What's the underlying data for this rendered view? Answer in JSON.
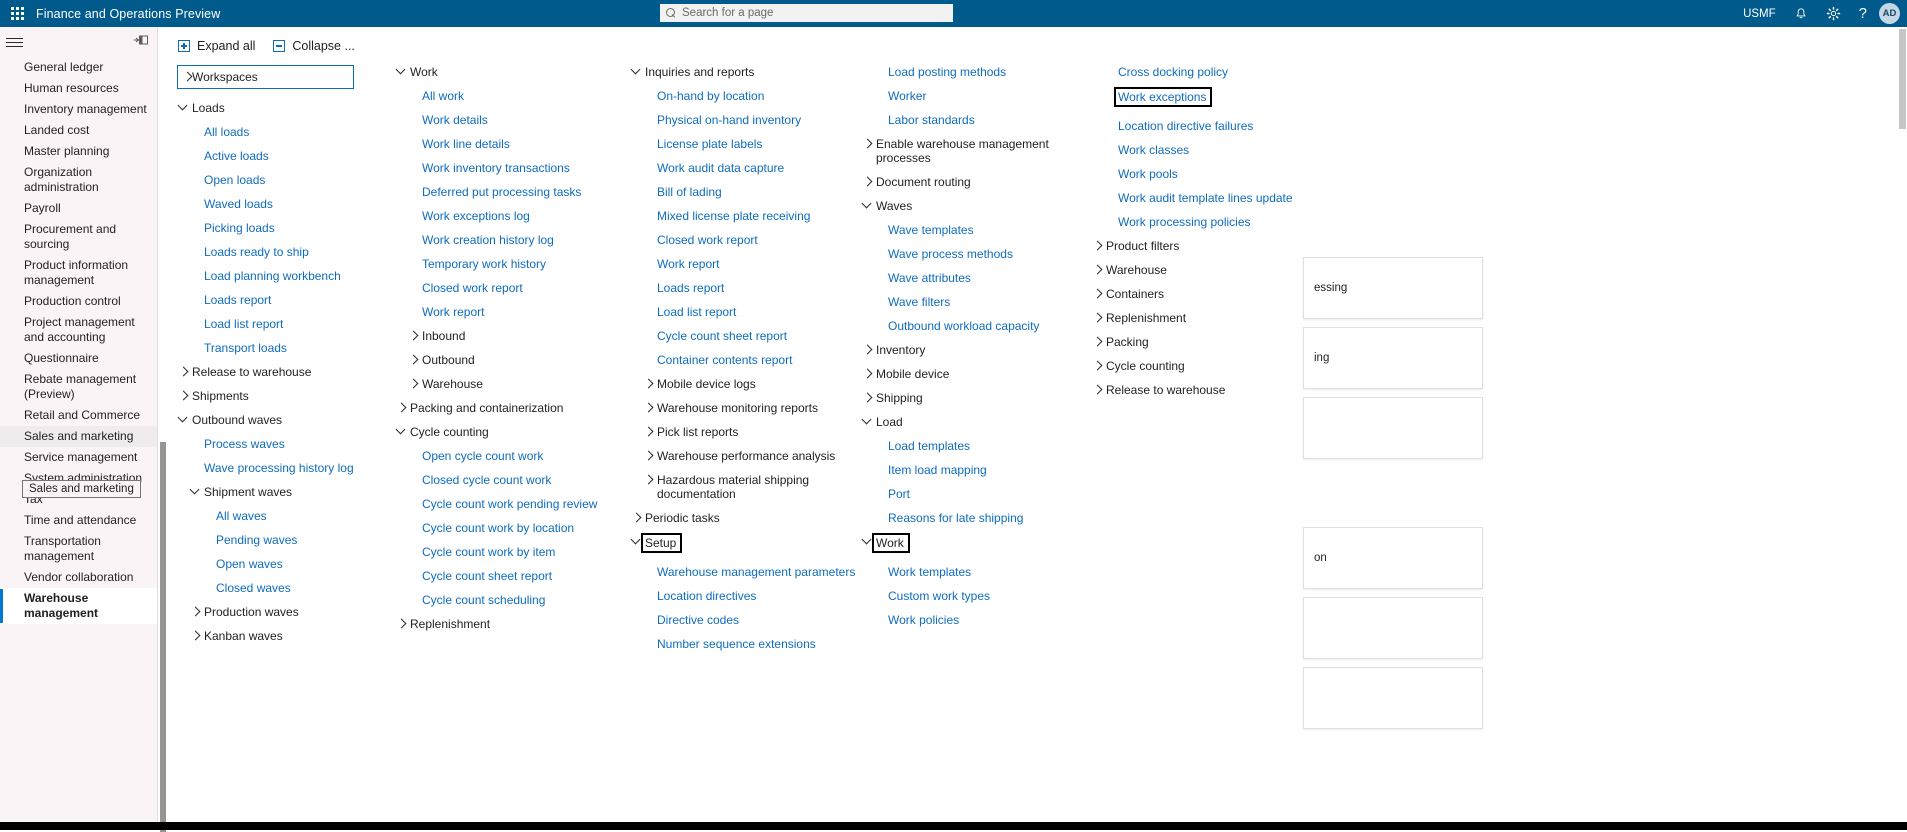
{
  "header": {
    "app_title": "Finance and Operations Preview",
    "waffle_icon": "waffle-grid-icon",
    "search_placeholder": "Search for a page",
    "search_icon": "search-icon",
    "company": "USMF",
    "notifications_icon": "bell-icon",
    "settings_icon": "gear-icon",
    "help_icon": "question-mark-icon",
    "avatar_initials": "AD",
    "accent_color": "#005A8C",
    "link_color": "#0F6CBD"
  },
  "sidebar": {
    "hamburger_icon": "hamburger-menu-icon",
    "pin_icon": "pin-panel-icon",
    "tooltip": "Sales and marketing",
    "items": [
      {
        "label": "General ledger",
        "state": "normal"
      },
      {
        "label": "Human resources",
        "state": "normal"
      },
      {
        "label": "Inventory management",
        "state": "normal"
      },
      {
        "label": "Landed cost",
        "state": "normal"
      },
      {
        "label": "Master planning",
        "state": "normal"
      },
      {
        "label": "Organization administration",
        "state": "normal"
      },
      {
        "label": "Payroll",
        "state": "normal"
      },
      {
        "label": "Procurement and sourcing",
        "state": "normal"
      },
      {
        "label": "Product information management",
        "state": "normal"
      },
      {
        "label": "Production control",
        "state": "normal"
      },
      {
        "label": "Project management and accounting",
        "state": "normal"
      },
      {
        "label": "Questionnaire",
        "state": "normal"
      },
      {
        "label": "Rebate management (Preview)",
        "state": "normal"
      },
      {
        "label": "Retail and Commerce",
        "state": "normal"
      },
      {
        "label": "Sales and marketing",
        "state": "hovered"
      },
      {
        "label": "Service management",
        "state": "normal"
      },
      {
        "label": "System administration",
        "state": "normal"
      },
      {
        "label": "Tax",
        "state": "normal"
      },
      {
        "label": "Time and attendance",
        "state": "normal"
      },
      {
        "label": "Transportation management",
        "state": "normal"
      },
      {
        "label": "Vendor collaboration",
        "state": "normal"
      },
      {
        "label": "Warehouse management",
        "state": "selected"
      }
    ]
  },
  "toolbar": {
    "expand_all": "Expand all",
    "collapse_all": "Collapse ...",
    "expand_icon": "expand-all-plus-icon",
    "collapse_icon": "collapse-all-minus-icon"
  },
  "columns": [
    {
      "id": "col1",
      "entries": [
        {
          "label": "Workspaces",
          "type": "group",
          "chev": "right",
          "focus": true
        },
        {
          "label": "Loads",
          "type": "group",
          "chev": "down"
        },
        {
          "label": "All loads",
          "type": "leaf"
        },
        {
          "label": "Active loads",
          "type": "leaf"
        },
        {
          "label": "Open loads",
          "type": "leaf"
        },
        {
          "label": "Waved loads",
          "type": "leaf"
        },
        {
          "label": "Picking loads",
          "type": "leaf"
        },
        {
          "label": "Loads ready to ship",
          "type": "leaf"
        },
        {
          "label": "Load planning workbench",
          "type": "leaf"
        },
        {
          "label": "Loads report",
          "type": "leaf"
        },
        {
          "label": "Load list report",
          "type": "leaf"
        },
        {
          "label": "Transport loads",
          "type": "leaf"
        },
        {
          "label": "Release to warehouse",
          "type": "group",
          "chev": "right"
        },
        {
          "label": "Shipments",
          "type": "group",
          "chev": "right"
        },
        {
          "label": "Outbound waves",
          "type": "group",
          "chev": "down"
        },
        {
          "label": "Process waves",
          "type": "leaf"
        },
        {
          "label": "Wave processing history log",
          "type": "leaf"
        },
        {
          "label": "Shipment waves",
          "type": "group-sub",
          "chev": "down"
        },
        {
          "label": "All waves",
          "type": "leaf-deep"
        },
        {
          "label": "Pending waves",
          "type": "leaf-deep"
        },
        {
          "label": "Open waves",
          "type": "leaf-deep"
        },
        {
          "label": "Closed waves",
          "type": "leaf-deep"
        },
        {
          "label": "Production waves",
          "type": "group-sub",
          "chev": "right"
        },
        {
          "label": "Kanban waves",
          "type": "group-sub",
          "chev": "right"
        }
      ]
    },
    {
      "id": "col2",
      "entries": [
        {
          "label": "Work",
          "type": "group",
          "chev": "down"
        },
        {
          "label": "All work",
          "type": "leaf"
        },
        {
          "label": "Work details",
          "type": "leaf"
        },
        {
          "label": "Work line details",
          "type": "leaf"
        },
        {
          "label": "Work inventory transactions",
          "type": "leaf"
        },
        {
          "label": "Deferred put processing tasks",
          "type": "leaf"
        },
        {
          "label": "Work exceptions log",
          "type": "leaf"
        },
        {
          "label": "Work creation history log",
          "type": "leaf"
        },
        {
          "label": "Temporary work history",
          "type": "leaf"
        },
        {
          "label": "Closed work report",
          "type": "leaf"
        },
        {
          "label": "Work report",
          "type": "leaf"
        },
        {
          "label": "Inbound",
          "type": "group-sub",
          "chev": "right"
        },
        {
          "label": "Outbound",
          "type": "group-sub",
          "chev": "right"
        },
        {
          "label": "Warehouse",
          "type": "group-sub",
          "chev": "right"
        },
        {
          "label": "Packing and containerization",
          "type": "group",
          "chev": "right"
        },
        {
          "label": "Cycle counting",
          "type": "group",
          "chev": "down"
        },
        {
          "label": "Open cycle count work",
          "type": "leaf"
        },
        {
          "label": "Closed cycle count work",
          "type": "leaf"
        },
        {
          "label": "Cycle count work pending review",
          "type": "leaf"
        },
        {
          "label": "Cycle count work by location",
          "type": "leaf"
        },
        {
          "label": "Cycle count work by item",
          "type": "leaf"
        },
        {
          "label": "Cycle count sheet report",
          "type": "leaf"
        },
        {
          "label": "Cycle count scheduling",
          "type": "leaf"
        },
        {
          "label": "Replenishment",
          "type": "group",
          "chev": "right"
        }
      ]
    },
    {
      "id": "col3",
      "entries": [
        {
          "label": "Inquiries and reports",
          "type": "group",
          "chev": "down"
        },
        {
          "label": "On-hand by location",
          "type": "leaf"
        },
        {
          "label": "Physical on-hand inventory",
          "type": "leaf"
        },
        {
          "label": "License plate labels",
          "type": "leaf"
        },
        {
          "label": "Work audit data capture",
          "type": "leaf"
        },
        {
          "label": "Bill of lading",
          "type": "leaf"
        },
        {
          "label": "Mixed license plate receiving",
          "type": "leaf"
        },
        {
          "label": "Closed work report",
          "type": "leaf"
        },
        {
          "label": "Work report",
          "type": "leaf"
        },
        {
          "label": "Loads report",
          "type": "leaf"
        },
        {
          "label": "Load list report",
          "type": "leaf"
        },
        {
          "label": "Cycle count sheet report",
          "type": "leaf"
        },
        {
          "label": "Container contents report",
          "type": "leaf"
        },
        {
          "label": "Mobile device logs",
          "type": "group-sub",
          "chev": "right"
        },
        {
          "label": "Warehouse monitoring reports",
          "type": "group-sub",
          "chev": "right"
        },
        {
          "label": "Pick list reports",
          "type": "group-sub",
          "chev": "right"
        },
        {
          "label": "Warehouse performance analysis",
          "type": "group-sub",
          "chev": "right"
        },
        {
          "label": "Hazardous material shipping documentation",
          "type": "group-sub-wrap",
          "chev": "right"
        },
        {
          "label": "Periodic tasks",
          "type": "group",
          "chev": "right"
        },
        {
          "label": "Setup",
          "type": "group",
          "chev": "down",
          "highlight": true
        },
        {
          "label": "Warehouse management parameters",
          "type": "leaf"
        },
        {
          "label": "Location directives",
          "type": "leaf"
        },
        {
          "label": "Directive codes",
          "type": "leaf"
        },
        {
          "label": "Number sequence extensions",
          "type": "leaf"
        }
      ]
    },
    {
      "id": "col4",
      "entries": [
        {
          "label": "Load posting methods",
          "type": "leaf"
        },
        {
          "label": "Worker",
          "type": "leaf"
        },
        {
          "label": "Labor standards",
          "type": "leaf"
        },
        {
          "label": "Enable warehouse management processes",
          "type": "group-wrap",
          "chev": "right"
        },
        {
          "label": "Document routing",
          "type": "group",
          "chev": "right"
        },
        {
          "label": "Waves",
          "type": "group",
          "chev": "down"
        },
        {
          "label": "Wave templates",
          "type": "leaf"
        },
        {
          "label": "Wave process methods",
          "type": "leaf"
        },
        {
          "label": "Wave attributes",
          "type": "leaf"
        },
        {
          "label": "Wave filters",
          "type": "leaf"
        },
        {
          "label": "Outbound workload capacity",
          "type": "leaf"
        },
        {
          "label": "Inventory",
          "type": "group",
          "chev": "right"
        },
        {
          "label": "Mobile device",
          "type": "group",
          "chev": "right"
        },
        {
          "label": "Shipping",
          "type": "group",
          "chev": "right"
        },
        {
          "label": "Load",
          "type": "group",
          "chev": "down"
        },
        {
          "label": "Load templates",
          "type": "leaf"
        },
        {
          "label": "Item load mapping",
          "type": "leaf"
        },
        {
          "label": "Port",
          "type": "leaf"
        },
        {
          "label": "Reasons for late shipping",
          "type": "leaf"
        },
        {
          "label": "Work",
          "type": "group",
          "chev": "down",
          "highlight": true
        },
        {
          "label": "Work templates",
          "type": "leaf"
        },
        {
          "label": "Custom work types",
          "type": "leaf"
        },
        {
          "label": "Work policies",
          "type": "leaf"
        }
      ]
    },
    {
      "id": "col5",
      "entries": [
        {
          "label": "Cross docking policy",
          "type": "leaf"
        },
        {
          "label": "Work exceptions",
          "type": "leaf",
          "highlight": true
        },
        {
          "label": "Location directive failures",
          "type": "leaf"
        },
        {
          "label": "Work classes",
          "type": "leaf"
        },
        {
          "label": "Work pools",
          "type": "leaf"
        },
        {
          "label": "Work audit template lines update",
          "type": "leaf"
        },
        {
          "label": "Work processing policies",
          "type": "leaf"
        },
        {
          "label": "Product filters",
          "type": "group",
          "chev": "right"
        },
        {
          "label": "Warehouse",
          "type": "group",
          "chev": "right"
        },
        {
          "label": "Containers",
          "type": "group",
          "chev": "right"
        },
        {
          "label": "Replenishment",
          "type": "group",
          "chev": "right"
        },
        {
          "label": "Packing",
          "type": "group",
          "chev": "right"
        },
        {
          "label": "Cycle counting",
          "type": "group",
          "chev": "right"
        },
        {
          "label": "Release to warehouse",
          "type": "group",
          "chev": "right"
        }
      ]
    }
  ],
  "peek_cards": [
    {
      "text": "essing"
    },
    {
      "text": "ing"
    },
    {
      "text": ""
    },
    {
      "text": "on"
    },
    {
      "text": ""
    },
    {
      "text": ""
    }
  ]
}
